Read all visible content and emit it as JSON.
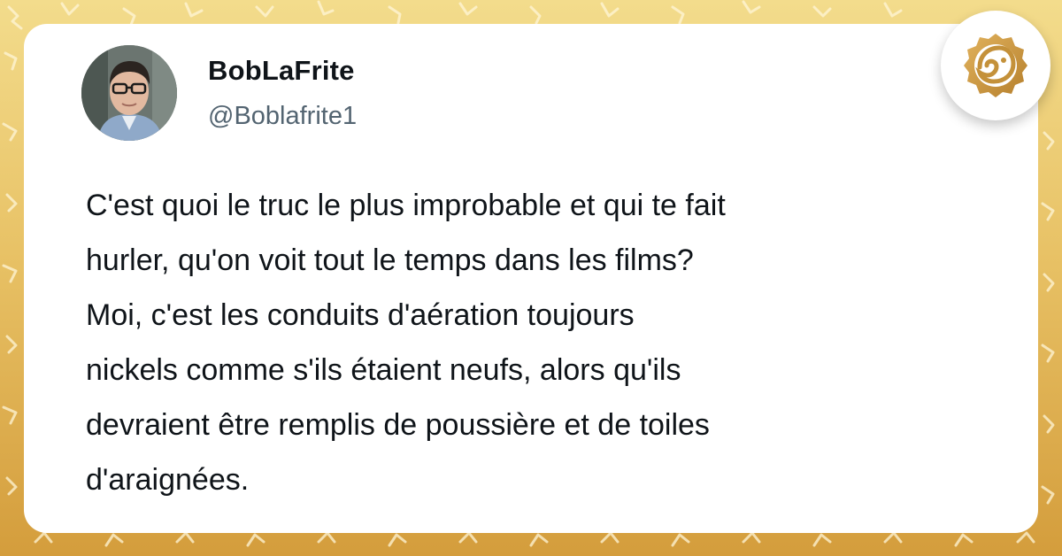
{
  "tweet": {
    "display_name": "BobLaFrite",
    "handle": "@Boblafrite1",
    "text_lines": [
      "C'est quoi le truc le plus improbable et qui te fait",
      "hurler, qu'on voit tout le temps dans les films?",
      "Moi, c'est les conduits d'aération toujours",
      "nickels comme s'ils étaient neufs, alors qu'ils",
      "devraient être remplis de poussière et de toiles",
      "d'araignées."
    ]
  },
  "icons": {
    "avatar": "profile-photo-avatar",
    "brand": "brand-logo-icon"
  },
  "colors": {
    "background_top": "#f3dc8c",
    "background_bottom": "#d49d3c",
    "card": "#ffffff",
    "text_primary": "#0f1419",
    "text_secondary": "#536471",
    "brand": "#c4913a"
  }
}
